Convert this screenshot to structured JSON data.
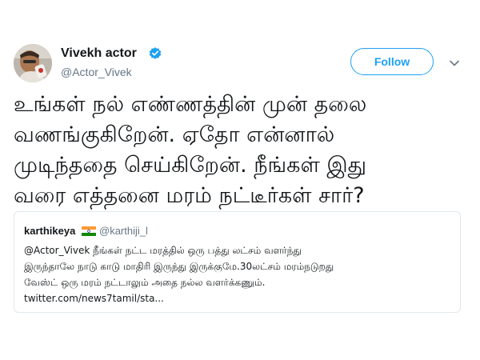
{
  "tweet": {
    "author": {
      "name": "Vivekh actor",
      "handle": "@Actor_Vivek",
      "verified": true
    },
    "follow_label": "Follow",
    "text_lines": [
      "உங்கள் நல் எண்ணத்தின் முன் தலை",
      "வணங்குகிறேன். ஏதோ என்னால்",
      "முடிந்ததை செய்கிறேன். நீங்கள் இது",
      "வரை எத்தனை மரம் நட்டீர்கள் சார்?"
    ]
  },
  "quoted": {
    "name": "karthikeya",
    "handle": "@karthiji_l",
    "text_lines": [
      "@Actor_Vivek  நீங்கள் நட்ட மரத்தில் ஒரு பத்து லட்சம் வளர்ந்து",
      "இருந்தாலே நாடு காடு மாதிரி இருந்து இருக்குமே.30லட்சம் மரம்நடுறது",
      "வேஸ்ட் ஒரு மரம் நட்டாலும் அதை நல்ல வளர்க்கணும்.",
      "twitter.com/news7tamil/sta..."
    ]
  },
  "colors": {
    "accent": "#1da1f2",
    "text": "#14171a",
    "muted": "#657786",
    "border": "#e1e8ed"
  },
  "icons": {
    "verified": "verified-badge-icon",
    "more": "chevron-down-icon",
    "flag": "india-flag-icon"
  }
}
